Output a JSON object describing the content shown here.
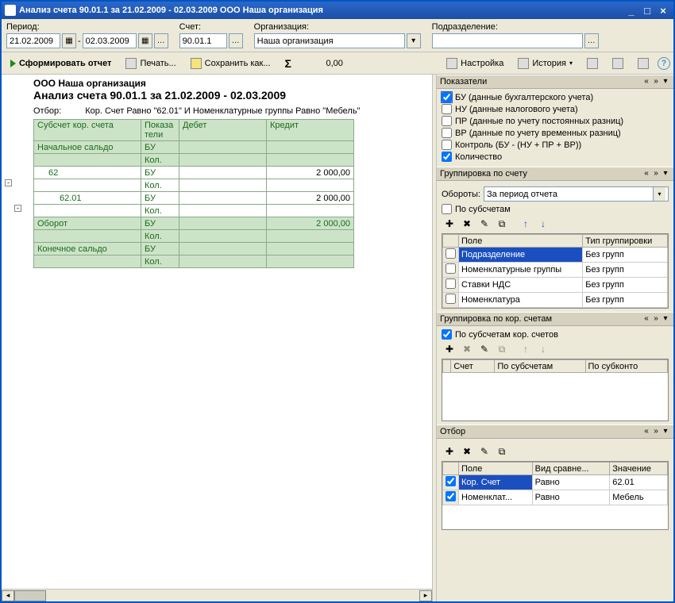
{
  "title": "Анализ счета 90.01.1 за 21.02.2009 - 02.03.2009 ООО Наша организация",
  "filters": {
    "period_label": "Период:",
    "date_from": "21.02.2009",
    "date_to": "02.03.2009",
    "dash": "-",
    "account_label": "Счет:",
    "account": "90.01.1",
    "org_label": "Организация:",
    "org": "Наша организация",
    "dept_label": "Подразделение:",
    "dept": ""
  },
  "toolbar": {
    "form": "Сформировать отчет",
    "print": "Печать...",
    "save": "Сохранить как...",
    "sum_value": "0,00",
    "settings": "Настройка",
    "history": "История"
  },
  "report": {
    "org": "ООО Наша организация",
    "title": "Анализ счета 90.01.1 за 21.02.2009 - 02.03.2009",
    "filter_lbl": "Отбор:",
    "filter_text": "Кор. Счет Равно \"62.01\" И Номенклатурные группы Равно \"Мебель\"",
    "cols": {
      "c1": "Субсчет кор. счета",
      "c2": "Показа\nтели",
      "c3": "Дебет",
      "c4": "Кредит"
    },
    "rows": {
      "r1a": "Начальное сальдо",
      "r1b": "БУ",
      "r1c": "Кол.",
      "r2a": "62",
      "r2b": "БУ",
      "r2c": "Кол.",
      "r2v": "2 000,00",
      "r3a": "62.01",
      "r3b": "БУ",
      "r3c": "Кол.",
      "r3v": "2 000,00",
      "r4a": "Оборот",
      "r4b": "БУ",
      "r4c": "Кол.",
      "r4v": "2 000,00",
      "r5a": "Конечное сальдо",
      "r5b": "БУ",
      "r5c": "Кол."
    }
  },
  "panels": {
    "p1": {
      "title": "Показатели",
      "items": {
        "a": "БУ (данные бухгалтерского учета)",
        "b": "НУ (данные налогового учета)",
        "c": "ПР (данные по учету постоянных разниц)",
        "d": "ВР (данные по учету временных разниц)",
        "e": "Контроль (БУ - (НУ + ПР + ВР))",
        "f": "Количество"
      }
    },
    "p2": {
      "title": "Группировка по счету",
      "turnover_lbl": "Обороты:",
      "turnover_val": "За период отчета",
      "bysub": "По субсчетам",
      "cols": {
        "c1": "Поле",
        "c2": "Тип группировки"
      },
      "rows": {
        "r1a": "Подразделение",
        "r1b": "Без групп",
        "r2a": "Номенклатурные группы",
        "r2b": "Без групп",
        "r3a": "Ставки НДС",
        "r3b": "Без групп",
        "r4a": "Номенклатура",
        "r4b": "Без групп"
      }
    },
    "p3": {
      "title": "Группировка по кор. счетам",
      "bysub": "По субсчетам кор. счетов",
      "cols": {
        "c1": "Счет",
        "c2": "По субсчетам",
        "c3": "По субконто"
      }
    },
    "p4": {
      "title": "Отбор",
      "cols": {
        "c1": "Поле",
        "c2": "Вид сравне...",
        "c3": "Значение"
      },
      "rows": {
        "r1a": "Кор. Счет",
        "r1b": "Равно",
        "r1c": "62.01",
        "r2a": "Номенклат...",
        "r2b": "Равно",
        "r2c": "Мебель"
      }
    }
  }
}
